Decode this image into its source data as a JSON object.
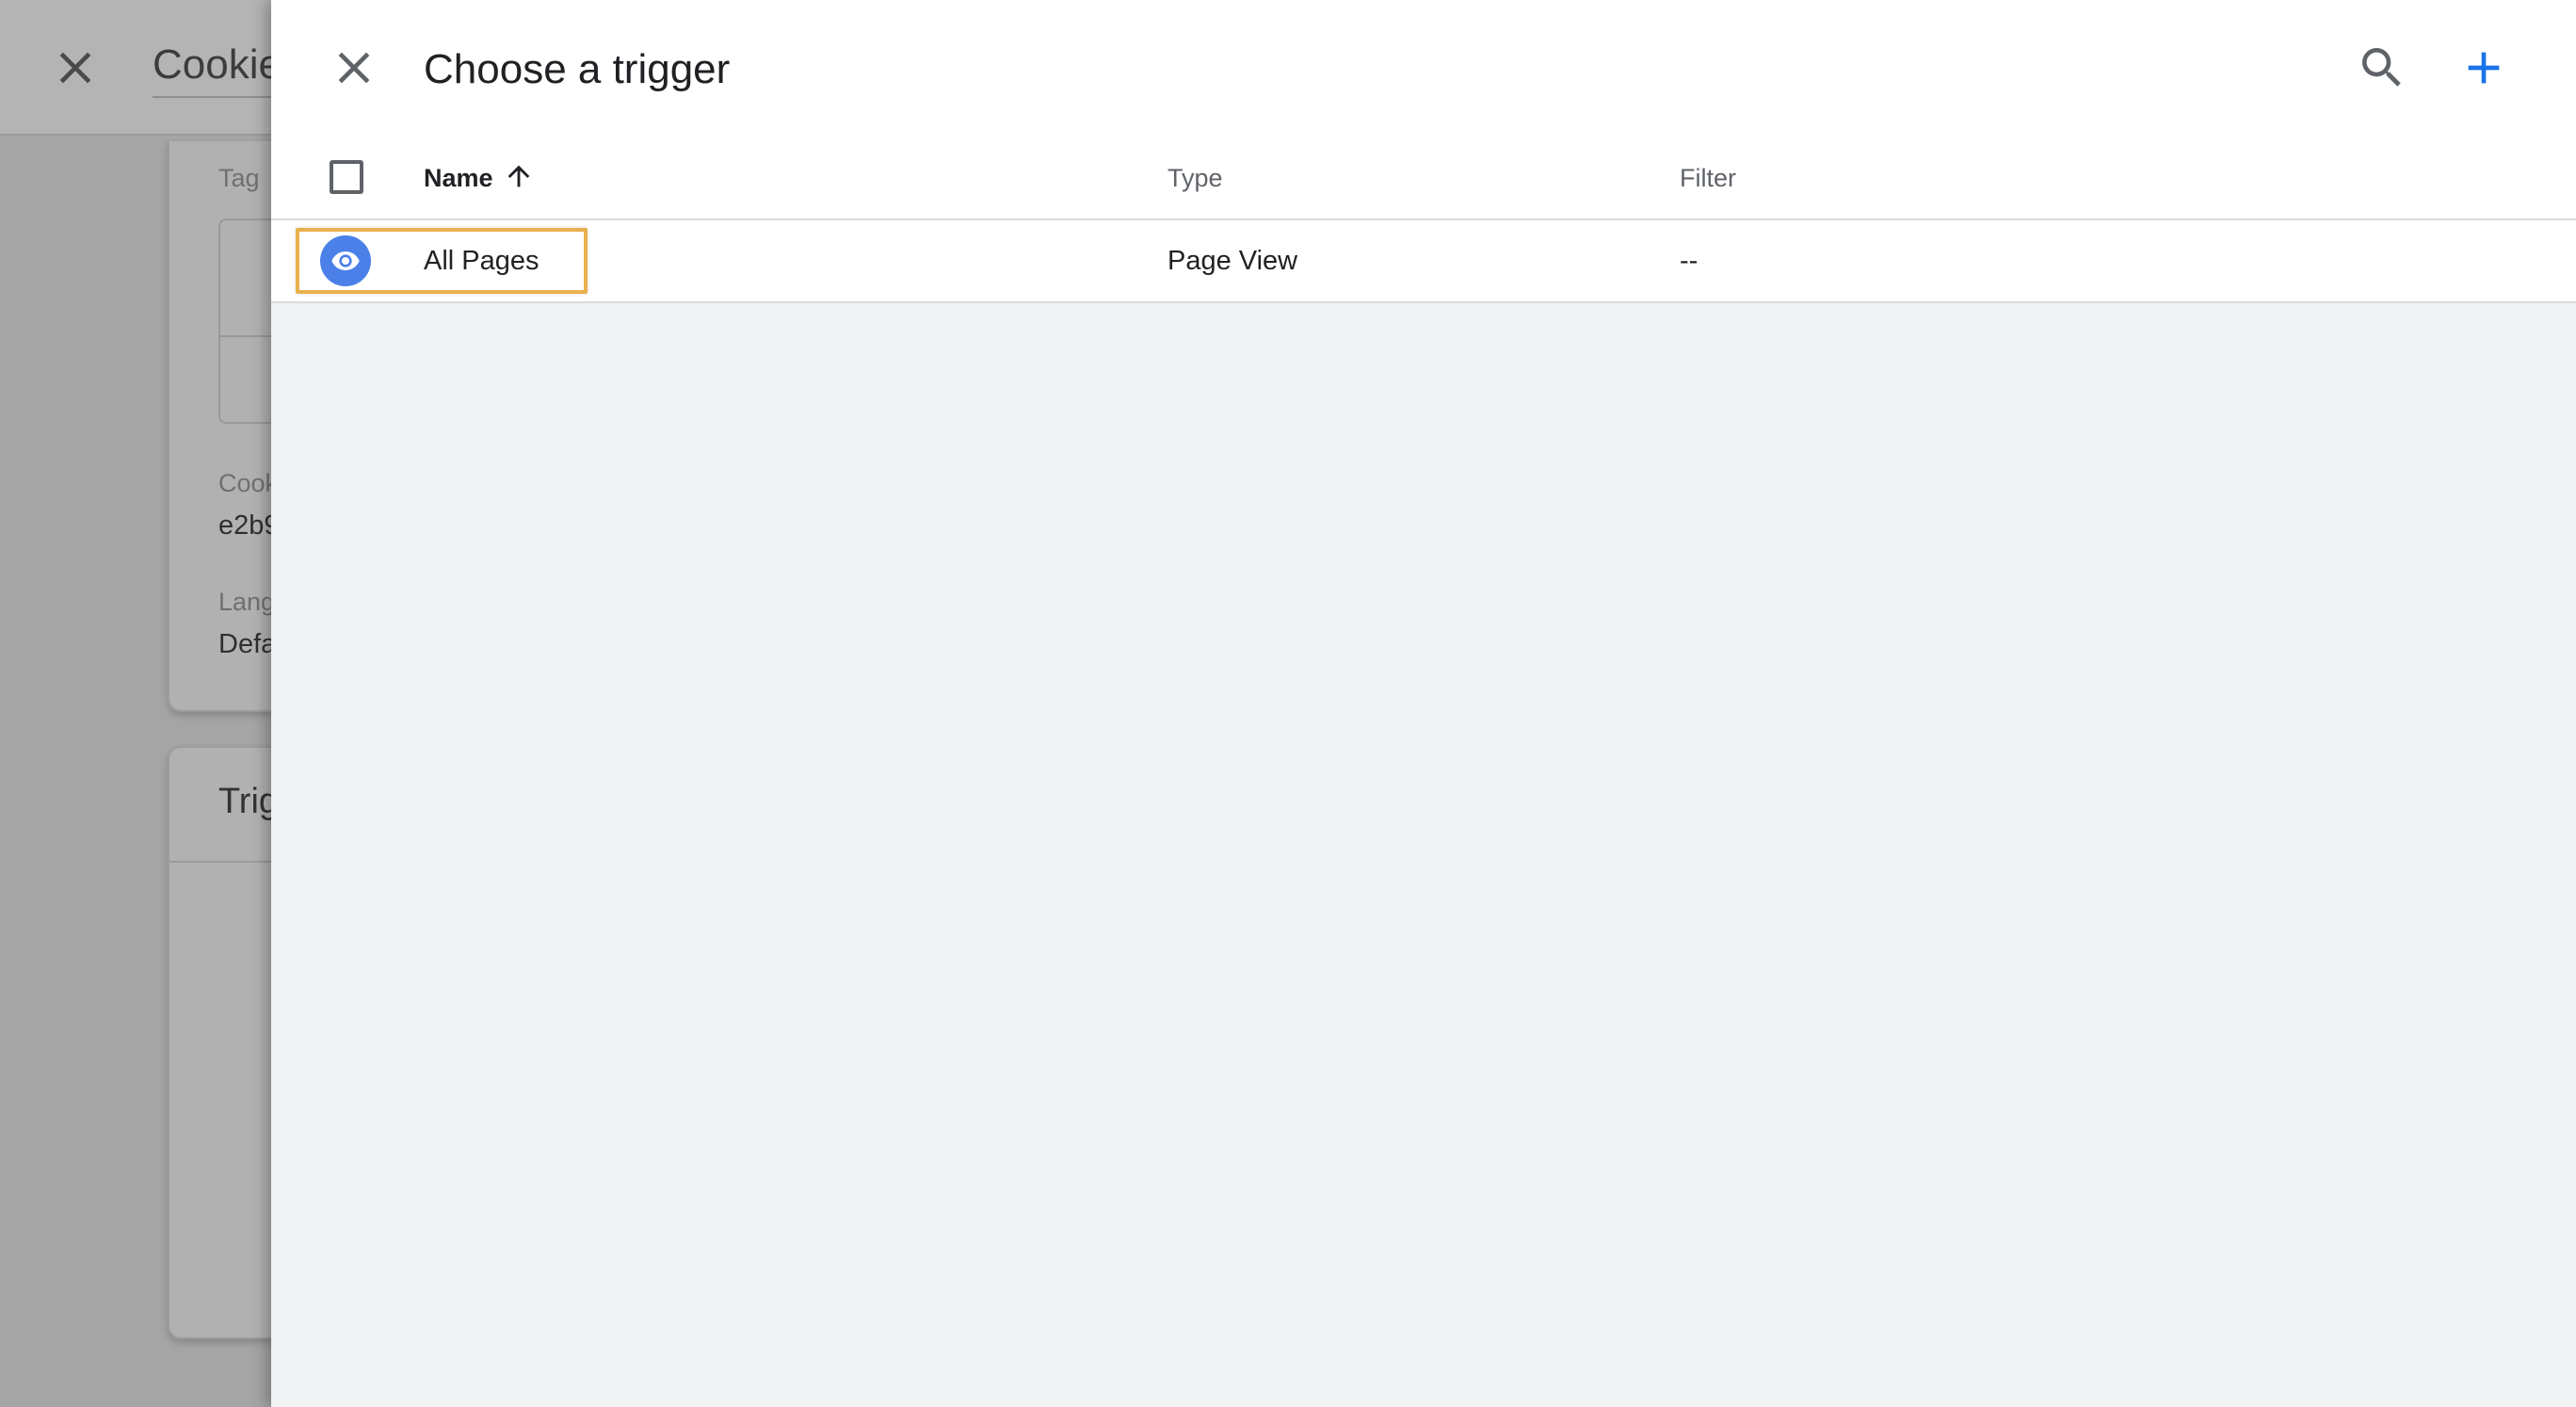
{
  "background_editor": {
    "title": "Cookie",
    "config_card": {
      "tag_label": "Tag",
      "cookie_label": "Cook",
      "cookie_value": "e2b9",
      "language_label": "Lang",
      "language_value": "Defa"
    },
    "triggering_card": {
      "title": "Trig"
    }
  },
  "panel": {
    "title": "Choose a trigger",
    "header_actions": {
      "search_icon": "search-icon",
      "add_icon": "plus-icon",
      "close_icon": "close-icon"
    },
    "table": {
      "columns": [
        {
          "label": "Name",
          "sort": "ascending"
        },
        {
          "label": "Type"
        },
        {
          "label": "Filter"
        }
      ],
      "rows": [
        {
          "icon": "eye-icon",
          "name": "All Pages",
          "type": "Page View",
          "filter": "--"
        }
      ]
    }
  },
  "colors": {
    "accent_blue": "#1a73e8",
    "eye_badge": "#4a80e8",
    "highlight_border": "#e8b14c",
    "panel_background": "#f0f2f4"
  }
}
